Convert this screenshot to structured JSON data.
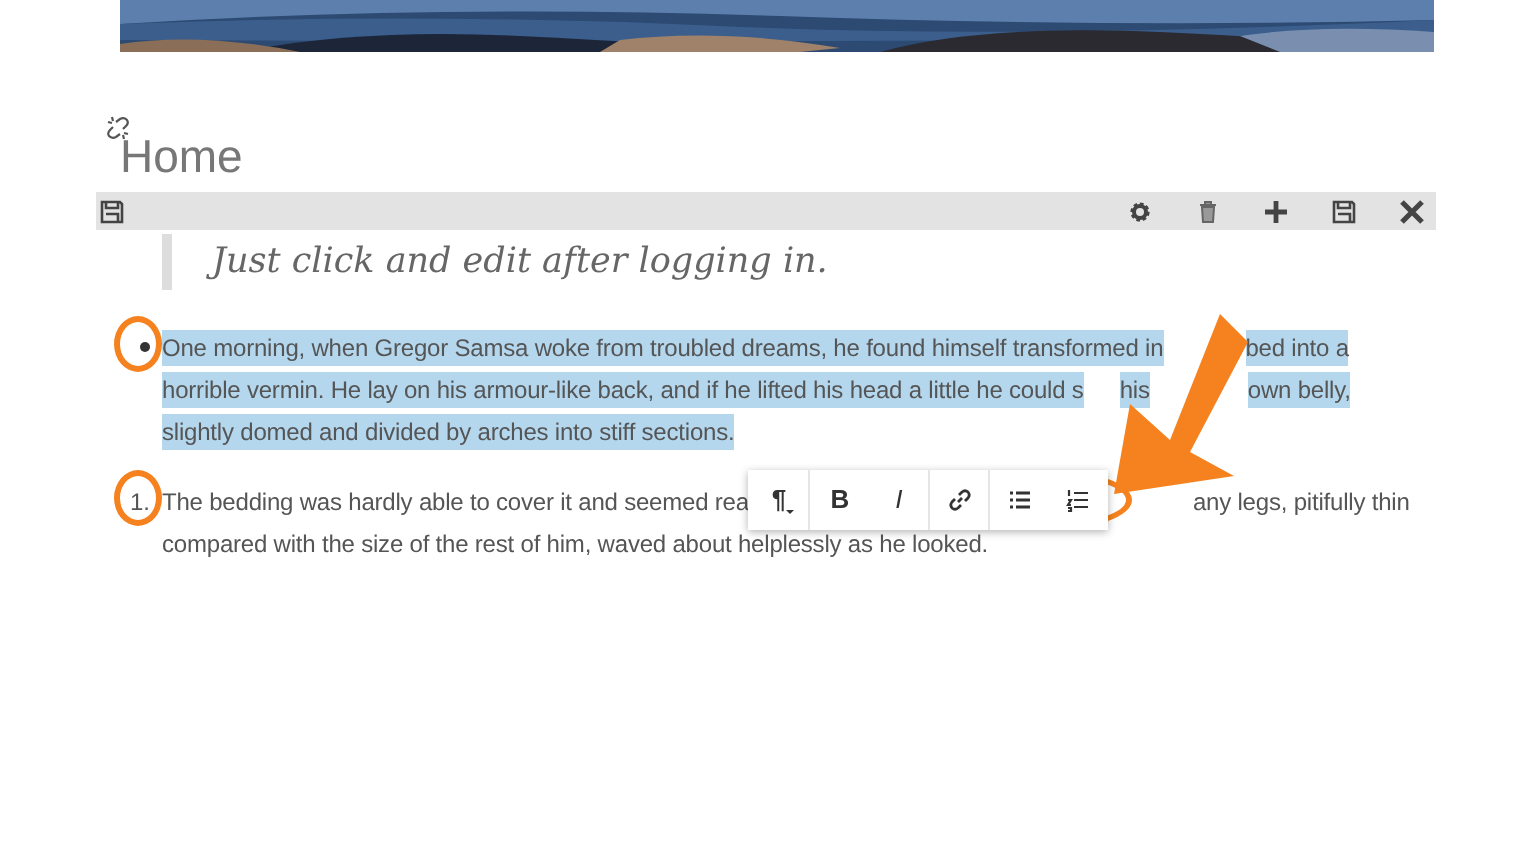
{
  "page": {
    "title": "Home"
  },
  "edit_bar": {
    "tools": [
      {
        "kind": "settings"
      },
      {
        "kind": "delete"
      },
      {
        "kind": "add"
      },
      {
        "kind": "save"
      },
      {
        "kind": "close"
      }
    ]
  },
  "blockquote": "Just click and edit after logging in.",
  "lists": [
    {
      "kind": "bullet",
      "selected": true,
      "lines": [
        [
          "One morning, when Gregor Samsa woke from troubled dreams, he found himself transformed in",
          "bed into a"
        ],
        [
          "horrible vermin. He lay on his armour-like back, and if he lifted his head a little he could s",
          "his",
          "own belly,"
        ],
        [
          "slightly domed and divided by arches into stiff sections."
        ]
      ]
    },
    {
      "kind": "number",
      "marker": "1.",
      "selected": false,
      "lines": [
        [
          "The bedding was hardly able to cover it and seemed rea",
          "any legs, pitifully thin"
        ],
        [
          "compared with the size of the rest of him, waved about helplessly as he looked."
        ]
      ]
    }
  ],
  "format_toolbar": {
    "buttons": [
      {
        "kind": "paragraph",
        "label": "¶"
      },
      {
        "kind": "bold",
        "label": "B"
      },
      {
        "kind": "italic",
        "label": "I"
      },
      {
        "kind": "link"
      },
      {
        "kind": "bullet-list"
      },
      {
        "kind": "numbered-list"
      }
    ]
  }
}
